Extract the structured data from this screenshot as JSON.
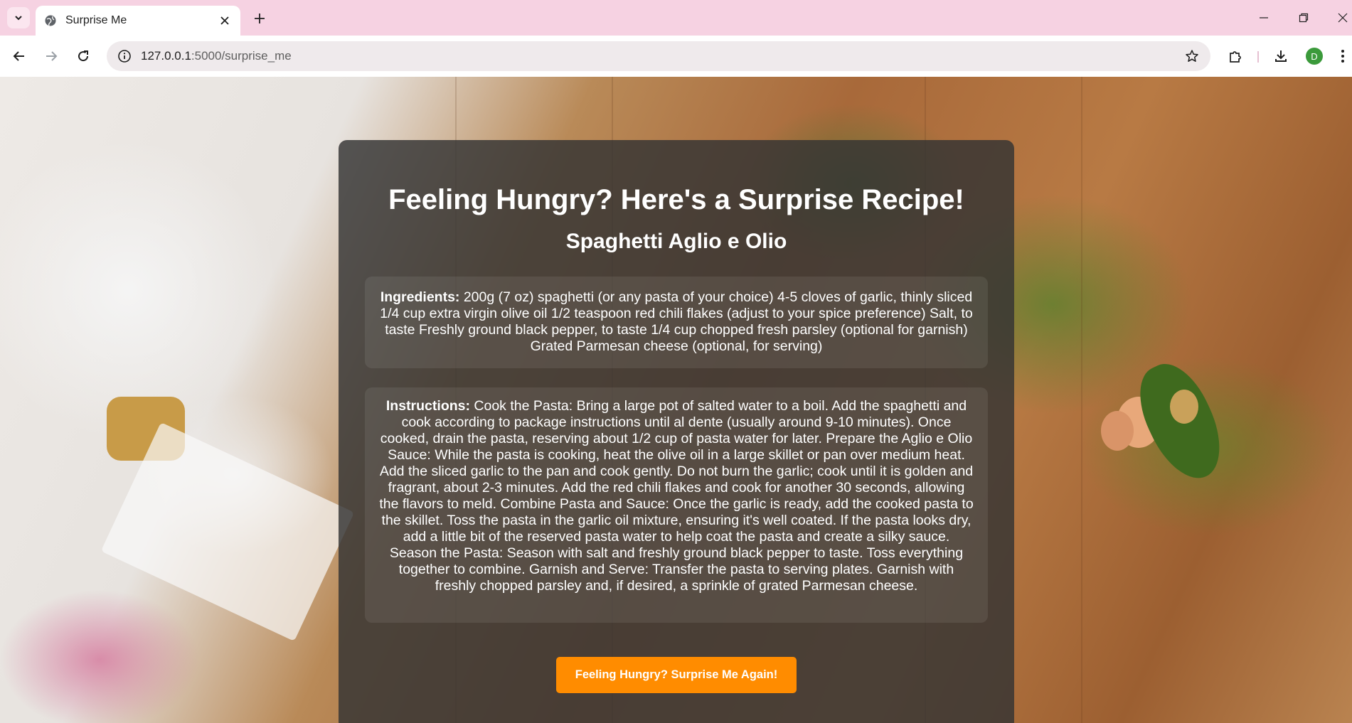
{
  "browser": {
    "tab": {
      "title": "Surprise Me"
    },
    "address": {
      "host": "127.0.0.1",
      "rest": ":5000/surprise_me"
    },
    "profile_initial": "D",
    "icons": {
      "tab_search": "chevron-down-icon",
      "favicon": "globe-icon",
      "tab_close": "close-icon",
      "new_tab": "plus-icon",
      "back": "arrow-left-icon",
      "forward": "arrow-right-icon",
      "reload": "reload-icon",
      "site_info": "info-icon",
      "bookmark": "star-icon",
      "extensions": "puzzle-icon",
      "downloads": "download-icon",
      "menu": "kebab-menu-icon"
    }
  },
  "page": {
    "heading": "Feeling Hungry? Here's a Surprise Recipe!",
    "recipe_name": "Spaghetti Aglio e Olio",
    "ingredients_label": "Ingredients:",
    "ingredients_text": "200g (7 oz) spaghetti (or any pasta of your choice) 4-5 cloves of garlic, thinly sliced 1/4 cup extra virgin olive oil 1/2 teaspoon red chili flakes (adjust to your spice preference) Salt, to taste Freshly ground black pepper, to taste 1/4 cup chopped fresh parsley (optional for garnish) Grated Parmesan cheese (optional, for serving)",
    "instructions_label": "Instructions:",
    "instructions_text": "Cook the Pasta: Bring a large pot of salted water to a boil. Add the spaghetti and cook according to package instructions until al dente (usually around 9-10 minutes). Once cooked, drain the pasta, reserving about 1/2 cup of pasta water for later. Prepare the Aglio e Olio Sauce: While the pasta is cooking, heat the olive oil in a large skillet or pan over medium heat. Add the sliced garlic to the pan and cook gently. Do not burn the garlic; cook until it is golden and fragrant, about 2-3 minutes. Add the red chili flakes and cook for another 30 seconds, allowing the flavors to meld. Combine Pasta and Sauce: Once the garlic is ready, add the cooked pasta to the skillet. Toss the pasta in the garlic oil mixture, ensuring it's well coated. If the pasta looks dry, add a little bit of the reserved pasta water to help coat the pasta and create a silky sauce. Season the Pasta: Season with salt and freshly ground black pepper to taste. Toss everything together to combine. Garnish and Serve: Transfer the pasta to serving plates. Garnish with freshly chopped parsley and, if desired, a sprinkle of grated Parmesan cheese.",
    "button_label": "Feeling Hungry? Surprise Me Again!"
  },
  "colors": {
    "tabbar": "#f6d2e2",
    "card_bg": "#333333",
    "button_bg": "#ff8c00",
    "text": "#ffffff"
  }
}
